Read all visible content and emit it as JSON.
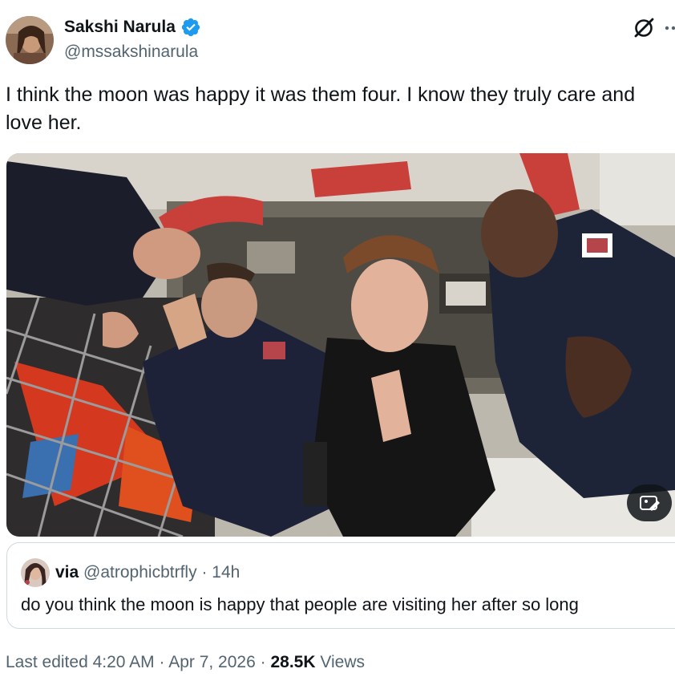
{
  "author": {
    "display_name": "Sakshi Narula",
    "handle": "@mssakshinarula",
    "verified_icon": "verified-badge-icon"
  },
  "header_icons": [
    "grok-icon",
    "more-icon"
  ],
  "tweet": {
    "text": "I think the moon was happy it was them four. I know they truly care and love her."
  },
  "media": {
    "image_icon": "photo",
    "edit_icon": "edit-image-icon"
  },
  "quote": {
    "name": "via",
    "handle": "@atrophicbtrfly",
    "separator": "·",
    "time": "14h",
    "text": "do you think the moon is happy that people are visiting her after so long"
  },
  "footer": {
    "edited_label": "Last edited",
    "time": "4:20 AM",
    "date": "Apr 7, 2026",
    "separator": "·",
    "views_count": "28.5K",
    "views_label": "Views"
  },
  "colors": {
    "text_primary": "#0f1419",
    "text_secondary": "#536471",
    "verified_blue": "#1d9bf0",
    "border": "#cfd9de"
  }
}
